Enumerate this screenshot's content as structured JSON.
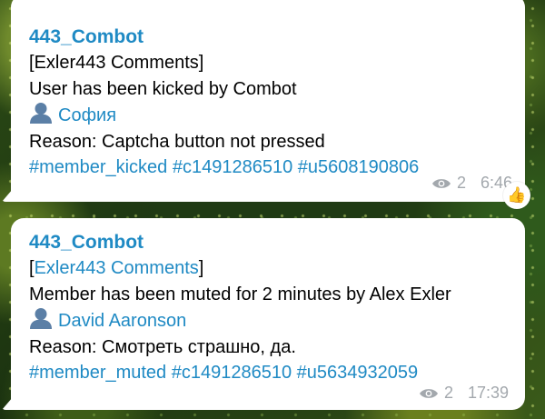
{
  "messages": [
    {
      "sender": "443_Combot",
      "chat_bracket_open": "[",
      "chat_name": "Exler443 Comments",
      "chat_bracket_close": "]",
      "action": "User has been kicked by Combot",
      "user_name": "София",
      "reason": "Reason: Captcha button not pressed",
      "hashtags": "#member_kicked #c1491286510 #u5608190806",
      "views": "2",
      "time": "6:46",
      "reaction": "👍"
    },
    {
      "sender": "443_Combot",
      "chat_bracket_open": "[",
      "chat_name": "Exler443 Comments",
      "chat_bracket_close": "]",
      "action": "Member has been muted for 2 minutes by Alex Exler",
      "user_name": "David Aaronson",
      "reason": "Reason: Смотреть страшно, да.",
      "hashtags": "#member_muted #c1491286510 #u5634932059",
      "views": "2",
      "time": "17:39"
    }
  ],
  "colors": {
    "link": "#1f8ac4",
    "meta": "#a3a8ad",
    "bubble": "#ffffff"
  }
}
